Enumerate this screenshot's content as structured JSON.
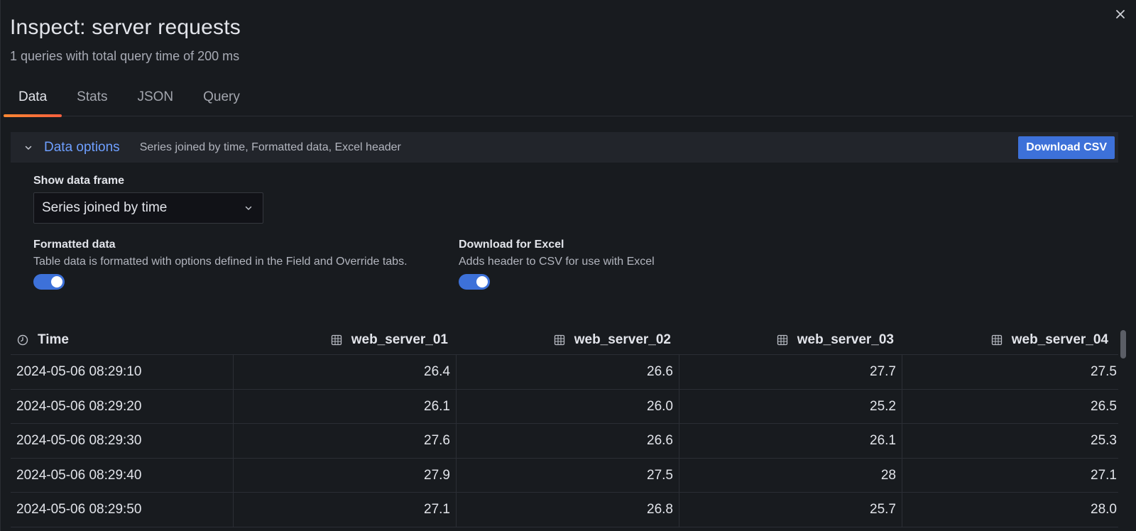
{
  "drawer": {
    "title": "Inspect: server requests",
    "subtitle": "1 queries with total query time of 200 ms",
    "close_icon": "close-icon"
  },
  "tabs": [
    {
      "label": "Data",
      "active": true
    },
    {
      "label": "Stats",
      "active": false
    },
    {
      "label": "JSON",
      "active": false
    },
    {
      "label": "Query",
      "active": false
    }
  ],
  "data_options": {
    "title": "Data options",
    "summary": "Series joined by time, Formatted data, Excel header",
    "download_label": "Download CSV",
    "expanded": true
  },
  "show_data_frame": {
    "label": "Show data frame",
    "selected": "Series joined by time"
  },
  "formatted_data": {
    "label": "Formatted data",
    "description": "Table data is formatted with options defined in the Field and Override tabs.",
    "enabled": true
  },
  "download_excel": {
    "label": "Download for Excel",
    "description": "Adds header to CSV for use with Excel",
    "enabled": true
  },
  "table": {
    "columns": [
      "Time",
      "web_server_01",
      "web_server_02",
      "web_server_03",
      "web_server_04"
    ],
    "rows": [
      [
        "2024-05-06 08:29:10",
        "26.4",
        "26.6",
        "27.7",
        "27.5"
      ],
      [
        "2024-05-06 08:29:20",
        "26.1",
        "26.0",
        "25.2",
        "26.5"
      ],
      [
        "2024-05-06 08:29:30",
        "27.6",
        "26.6",
        "26.1",
        "25.3"
      ],
      [
        "2024-05-06 08:29:40",
        "27.9",
        "27.5",
        "28",
        "27.1"
      ],
      [
        "2024-05-06 08:29:50",
        "27.1",
        "26.8",
        "25.7",
        "28.0"
      ]
    ]
  },
  "colors": {
    "background": "#181b1f",
    "accent_blue": "#3d71d9",
    "link_blue": "#6e9fff",
    "tab_underline": "#ff8833"
  }
}
